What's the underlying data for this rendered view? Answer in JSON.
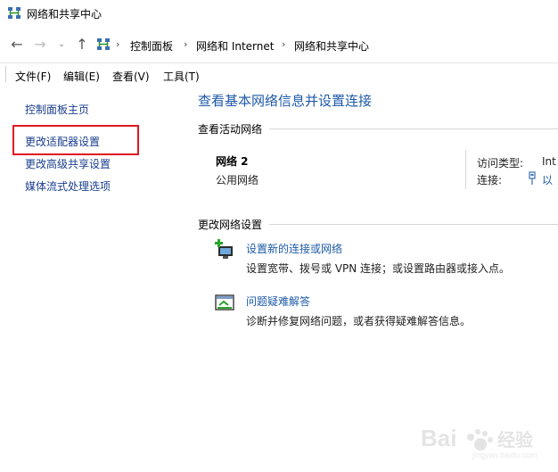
{
  "window": {
    "title": "网络和共享中心"
  },
  "address": {
    "crumbs": [
      "控制面板",
      "网络和 Internet",
      "网络和共享中心"
    ]
  },
  "menu": {
    "items": [
      "文件(F)",
      "编辑(E)",
      "查看(V)",
      "工具(T)"
    ]
  },
  "sidebar": {
    "items": [
      {
        "label": "控制面板主页"
      },
      {
        "label": "更改适配器设置"
      },
      {
        "label": "更改高级共享设置"
      },
      {
        "label": "媒体流式处理选项"
      }
    ]
  },
  "main": {
    "title": "查看基本网络信息并设置连接",
    "active_networks_label": "查看活动网络",
    "network": {
      "name": "网络 2",
      "type": "公用网络",
      "access_type_label": "访问类型:",
      "access_type_value": "Int",
      "connection_label": "连接:",
      "connection_value": "以"
    },
    "change_settings_label": "更改网络设置",
    "tasks": [
      {
        "title": "设置新的连接或网络",
        "desc": "设置宽带、拨号或 VPN 连接；或设置路由器或接入点。",
        "icon": "new-connection-icon"
      },
      {
        "title": "问题疑难解答",
        "desc": "诊断并修复网络问题，或者获得疑难解答信息。",
        "icon": "troubleshoot-icon"
      }
    ]
  },
  "colors": {
    "link": "#1e5aa8",
    "highlight": "#e0191f"
  },
  "watermark": {
    "text": "Bai经验"
  }
}
